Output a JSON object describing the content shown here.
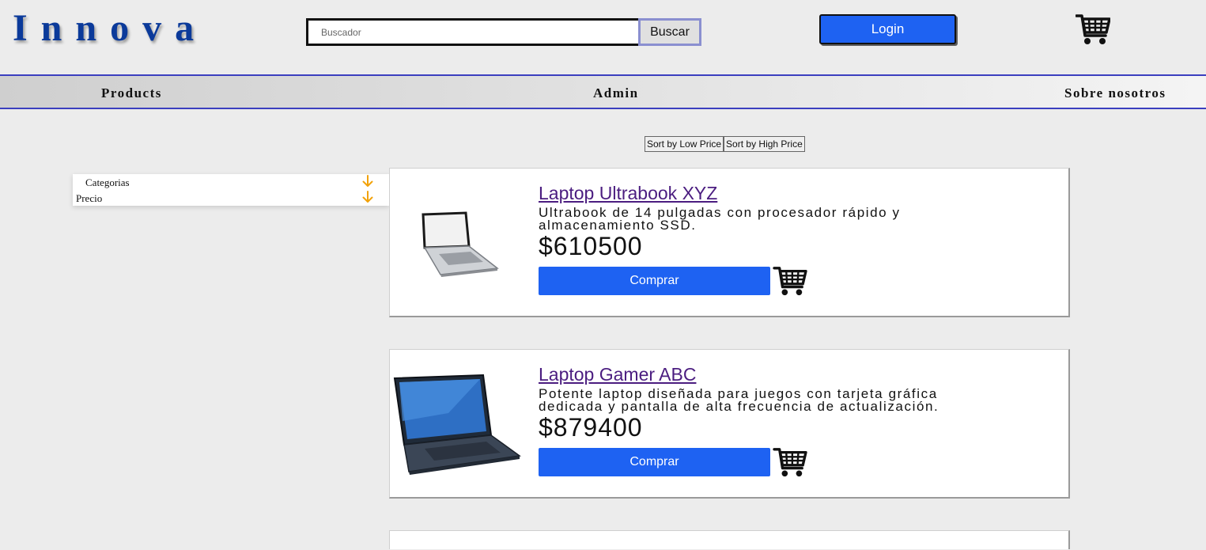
{
  "header": {
    "logo": "Innova",
    "search_placeholder": "Buscador",
    "search_button": "Buscar",
    "login_button": "Login",
    "cart_icon": "shopping-cart-icon"
  },
  "nav": {
    "items": [
      "Products",
      "Admin",
      "Sobre nosotros"
    ]
  },
  "sort": {
    "low": "Sort by Low Price",
    "high": "Sort by High Price"
  },
  "filters": {
    "categories": "Categorias",
    "price": "Precio",
    "arrow_icon": "arrow-down-icon",
    "arrow_color": "#f2a20a"
  },
  "products": [
    {
      "title": "Laptop Ultrabook XYZ",
      "description": "Ultrabook de 14 pulgadas con procesador rápido y almacenamiento SSD.",
      "price": "$610500",
      "buy_label": "Comprar"
    },
    {
      "title": "Laptop Gamer ABC",
      "description": "Potente laptop diseñada para juegos con tarjeta gráfica dedicada y pantalla de alta frecuencia de actualización.",
      "price": "$879400",
      "buy_label": "Comprar"
    }
  ],
  "colors": {
    "brand": "#0b3a9a",
    "primary_button": "#1e62f2",
    "nav_border": "#3b3fbf",
    "link_visited": "#4b1d80"
  }
}
